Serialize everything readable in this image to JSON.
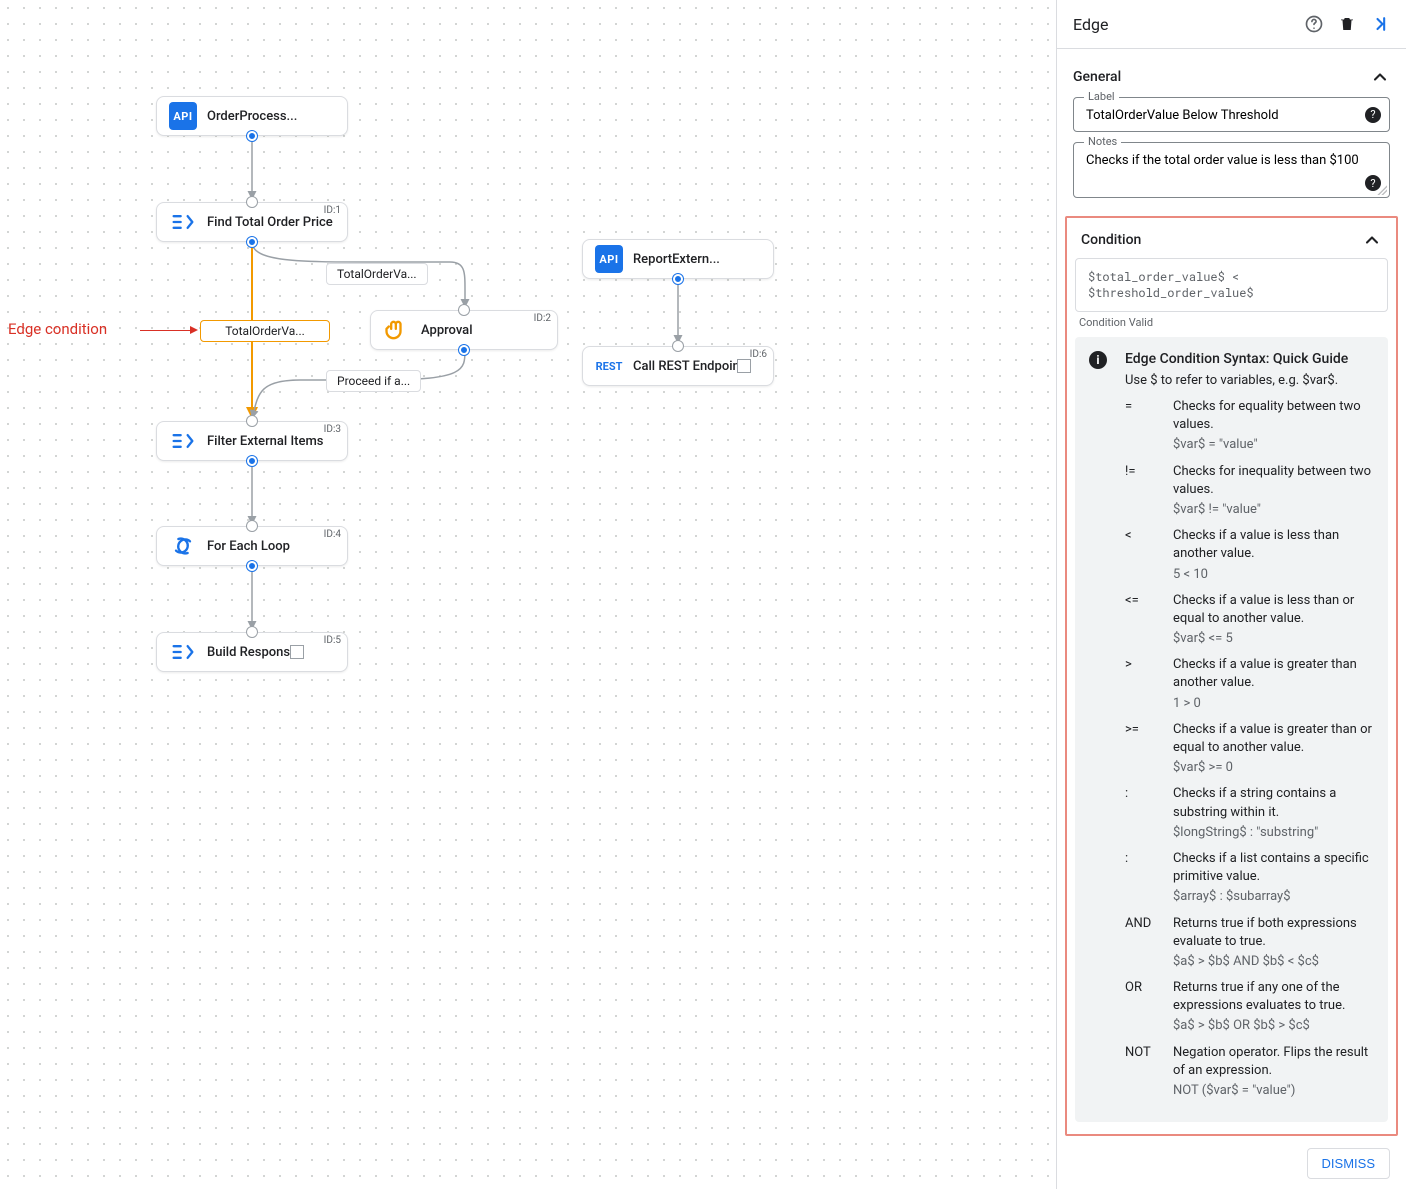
{
  "canvas": {
    "nodes": {
      "n0": {
        "label": "OrderProcess...",
        "icon": "API",
        "id": ""
      },
      "n1": {
        "label": "Find Total Order Price",
        "icon": "data",
        "id": "ID:1"
      },
      "n2": {
        "label": "Approval",
        "icon": "hand",
        "id": "ID:2"
      },
      "n3": {
        "label": "Filter External Items",
        "icon": "data",
        "id": "ID:3"
      },
      "n4": {
        "label": "For Each Loop",
        "icon": "loop",
        "id": "ID:4"
      },
      "n5": {
        "label": "Build Response",
        "icon": "data",
        "id": "ID:5"
      },
      "n6": {
        "label": "ReportExtern...",
        "icon": "API",
        "id": ""
      },
      "n7": {
        "label": "Call REST Endpoint",
        "icon": "REST",
        "id": "ID:6"
      }
    },
    "edges": {
      "e1": {
        "label": "TotalOrderVa..."
      },
      "e2": {
        "label": "TotalOrderVa..."
      },
      "e3": {
        "label": "Proceed if a..."
      }
    },
    "annotation": {
      "text": "Edge condition"
    }
  },
  "sidebar": {
    "title": "Edge",
    "general": {
      "heading": "General",
      "labelField": {
        "label": "Label",
        "value": "TotalOrderValue Below Threshold"
      },
      "notesField": {
        "label": "Notes",
        "value": "Checks if the total order value is less than $100"
      }
    },
    "condition": {
      "heading": "Condition",
      "expression": "$total_order_value$ < $threshold_order_value$",
      "status": "Condition Valid",
      "guide": {
        "title": "Edge Condition Syntax: Quick Guide",
        "subtitle": "Use $ to refer to variables, e.g. $var$.",
        "ops": [
          {
            "sym": "=",
            "desc": "Checks for equality between two values.",
            "ex": "$var$ = \"value\""
          },
          {
            "sym": "!=",
            "desc": "Checks for inequality between two values.",
            "ex": "$var$ != \"value\""
          },
          {
            "sym": "<",
            "desc": "Checks if a value is less than another value.",
            "ex": "5 < 10"
          },
          {
            "sym": "<=",
            "desc": "Checks if a value is less than or equal to another value.",
            "ex": "$var$ <= 5"
          },
          {
            "sym": ">",
            "desc": "Checks if a value is greater than another value.",
            "ex": "1 > 0"
          },
          {
            "sym": ">=",
            "desc": "Checks if a value is greater than or equal to another value.",
            "ex": "$var$ >= 0"
          },
          {
            "sym": ":",
            "desc": "Checks if a string contains a substring within it.",
            "ex": "$longString$ : \"substring\""
          },
          {
            "sym": ":",
            "desc": "Checks if a list contains a specific primitive value.",
            "ex": "$array$ : $subarray$"
          },
          {
            "sym": "AND",
            "desc": "Returns true if both expressions evaluate to true.",
            "ex": "$a$ > $b$ AND $b$ < $c$"
          },
          {
            "sym": "OR",
            "desc": "Returns true if any one of the expressions evaluates to true.",
            "ex": "$a$ > $b$ OR $b$ > $c$"
          },
          {
            "sym": "NOT",
            "desc": "Negation operator. Flips the result of an expression.",
            "ex": "NOT ($var$ = \"value\")"
          }
        ]
      }
    },
    "dismiss": "DISMISS"
  }
}
